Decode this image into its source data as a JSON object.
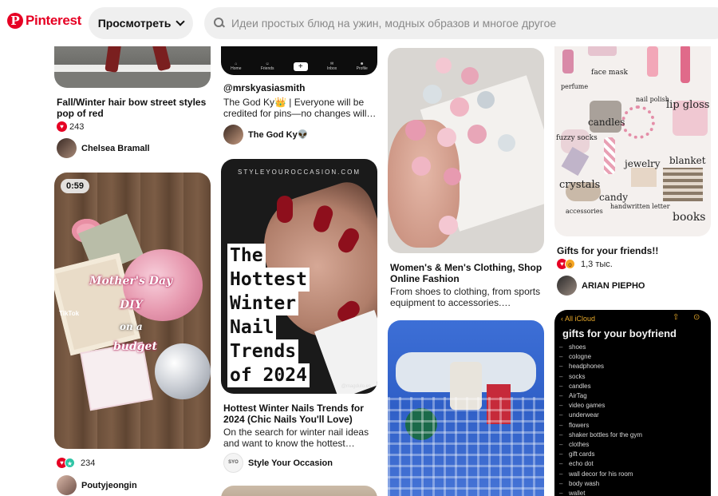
{
  "header": {
    "logo_text": "Pinterest",
    "browse_label": "Просмотреть",
    "search_placeholder": "Идеи простых блюд на ужин, модных образов и многое другое"
  },
  "colors": {
    "brand": "#e60023",
    "chip_bg": "#efefef"
  },
  "col1": {
    "pin1": {
      "title": "Fall/Winter hair bow street styles pop of red",
      "reaction_count": "243",
      "creator": "Chelsea Bramall"
    },
    "pin2": {
      "video_duration": "0:59",
      "image_caption_1": "Mother's Day",
      "image_caption_2": "DIY",
      "image_caption_3": "on a",
      "image_caption_4": "budget",
      "image_watermark": "TikTok",
      "reaction_count": "234",
      "creator": "Poutyjeongin"
    }
  },
  "col2": {
    "pin1": {
      "nav_items": [
        "Home",
        "Friends",
        "+",
        "Inbox",
        "Profile"
      ],
      "title": "@mrskyasiasmith",
      "description": "The God Ky👑 | Everyone will be credited for pins—no changes will…",
      "creator": "The God Ky👽"
    },
    "pin2": {
      "site_text": "STYLEYOUROCCASION.COM",
      "overlay": [
        "The",
        "Hottest",
        "Winter",
        "Nail",
        "Trends",
        "of 2024"
      ],
      "watermark": "@magdulo.es",
      "title": "Hottest Winter Nails Trends for 2024 (Chic Nails You'll Love)",
      "description": "On the search for winter nail ideas and want to know the hottest…",
      "creator_avatar_text": "SYO",
      "creator": "Style Your Occasion"
    }
  },
  "col3": {
    "pin1": {
      "title": "Women's & Men's Clothing, Shop Online Fashion",
      "description": "From shoes to clothing, from sports equipment to accessories.…"
    },
    "pin2": {}
  },
  "col4": {
    "pin1": {
      "collage_words": [
        "face mask",
        "perfume",
        "nail polish",
        "lip gloss",
        "candles",
        "fuzzy socks",
        "jewelry",
        "blanket",
        "crystals",
        "candy",
        "accessories",
        "handwritten letter",
        "books"
      ],
      "title": "Gifts for your friends!!",
      "reaction_count": "1,3 тыс.",
      "creator": "ARIAN PIEPHO"
    },
    "pin2": {
      "back_label": "All iCloud",
      "note_title": "gifts for your boyfriend",
      "note_items": [
        "shoes",
        "cologne",
        "headphones",
        "socks",
        "candles",
        "AirTag",
        "video games",
        "underwear",
        "flowers",
        "shaker bottles for the gym",
        "clothes",
        "gift cards",
        "echo dot",
        "wall decor for his room",
        "body wash",
        "wallet"
      ]
    }
  }
}
